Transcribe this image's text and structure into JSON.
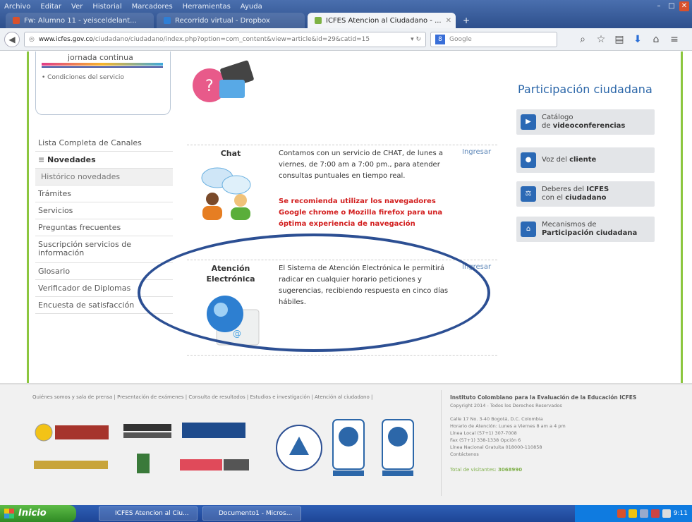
{
  "browser": {
    "menu": [
      "Archivo",
      "Editar",
      "Ver",
      "Historial",
      "Marcadores",
      "Herramientas",
      "Ayuda"
    ],
    "tabs": [
      {
        "label": "Fw: Alumno 11 - yeisceldelant...",
        "icon_color": "#d9512c"
      },
      {
        "label": "Recorrido virtual - Dropbox",
        "icon_color": "#2f7fd6"
      },
      {
        "label": "ICFES Atencion al Ciudadano - ...",
        "icon_color": "#7db243"
      }
    ],
    "url_host": "www.icfes.gov.co",
    "url_path": "/ciudadano/ciudadano/index.php?option=com_content&view=article&id=29&catid=15",
    "search_placeholder": "Google"
  },
  "jornada": {
    "title": "jornada continua",
    "link": "• Condiciones del servicio"
  },
  "leftnav": {
    "items": [
      "Lista Completa de Canales",
      "Novedades",
      "Histórico novedades",
      "Trámites",
      "Servicios",
      "Preguntas frecuentes",
      "Suscripción servicios de información",
      "Glosario",
      "Verificador de Diplomas",
      "Encuesta de satisfacción"
    ]
  },
  "channels": {
    "chat": {
      "title": "Chat",
      "text": "Contamos con un servicio de CHAT, de lunes a viernes, de 7:00 am a 7:00 pm., para atender consultas puntuales en tiempo real.",
      "warning": "Se recomienda utilizar los navegadores Google chrome o Mozilla firefox para una óptima experiencia de navegación",
      "link": "Ingresar"
    },
    "electronic": {
      "title": "Atención Electrónica",
      "text": "El Sistema de Atención Electrónica le permitirá radicar en cualquier horario peticiones y sugerencias, recibiendo respuesta en cinco días hábiles.",
      "link": "Ingresar"
    }
  },
  "participacion": {
    "title": "Participación ciudadana",
    "buttons": [
      {
        "line1": "Catálogo",
        "line2_prefix": "de ",
        "line2_bold": "videoconferencias"
      },
      {
        "line1": "Voz del ",
        "line1_bold": "cliente"
      },
      {
        "line1": "Deberes del ",
        "line1_bold": "ICFES",
        "line2_prefix": "con el ",
        "line2_bold": "ciudadano"
      },
      {
        "line1": "Mecanismos de",
        "line2_bold": "Participación ciudadana"
      }
    ]
  },
  "footer": {
    "links": "Quiénes somos y sala de prensa  |  Presentación de exámenes  |  Consulta de resultados  |  Estudios e investigación  |  Atención al ciudadano  |",
    "institution": "Instituto Colombiano para la Evaluación de la Educación ICFES",
    "copyright": "Copyright 2014 - Todos los Derechos Reservados",
    "address": "Calle 17 No. 3-40 Bogotá, D.C. Colombia\nHorario de Atención: Lunes a Viernes 8 am a 4 pm\nLínea Local (57+1) 307-7008\nFax (57+1) 338-1338 Opción 6\nLínea Nacional Gratuita 018000-110858\nContáctenos",
    "visitors_label": "Total de visitantes:",
    "visitors": "3068990"
  },
  "taskbar": {
    "start": "Inicio",
    "tasks": [
      "ICFES Atencion al Ciu...",
      "Documento1 - Micros..."
    ],
    "time": "9:11"
  }
}
